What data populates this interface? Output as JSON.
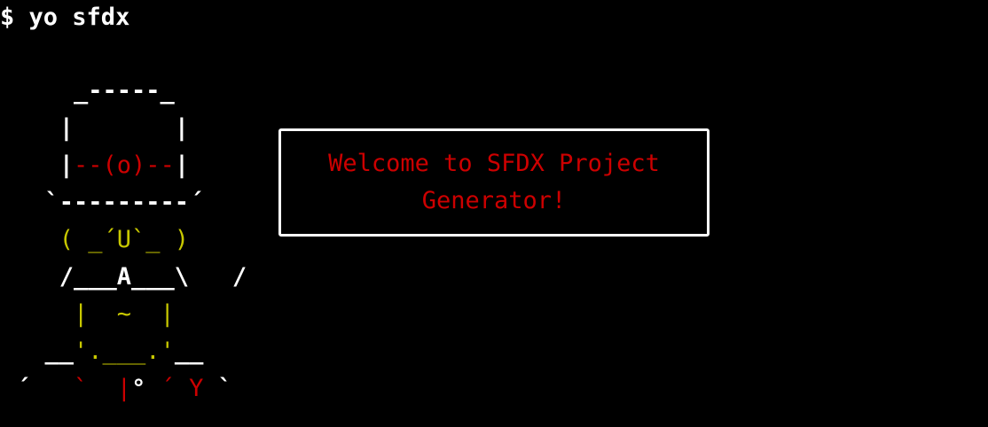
{
  "terminal": {
    "prompt_symbol": "$",
    "command": "yo sfdx"
  },
  "ascii_art": {
    "lines": [
      [
        {
          "text": "    _-----_",
          "color": "white"
        }
      ],
      [
        {
          "text": "   |       |",
          "color": "white"
        }
      ],
      [
        {
          "text": "   |",
          "color": "white"
        },
        {
          "text": "--(o)--",
          "color": "red"
        },
        {
          "text": "|",
          "color": "white"
        }
      ],
      [
        {
          "text": "  `---------´",
          "color": "white"
        }
      ],
      [
        {
          "text": "   ( _´U`_ )",
          "color": "yellow"
        }
      ],
      [
        {
          "text": "   /___A___\\   /",
          "color": "white"
        }
      ],
      [
        {
          "text": "    |  ~  |",
          "color": "yellow"
        }
      ],
      [
        {
          "text": "  __",
          "color": "white"
        },
        {
          "text": "'.___.'",
          "color": "yellow"
        },
        {
          "text": "__",
          "color": "white"
        }
      ],
      [
        {
          "text": "´   ",
          "color": "white"
        },
        {
          "text": "`  |",
          "color": "red"
        },
        {
          "text": "° ",
          "color": "white"
        },
        {
          "text": "´ Y",
          "color": "red"
        },
        {
          "text": " `",
          "color": "white"
        }
      ]
    ]
  },
  "message_box": {
    "line1": "Welcome to SFDX Project",
    "line2": "Generator!"
  },
  "colors": {
    "background": "#000000",
    "white": "#ffffff",
    "red": "#cc0000",
    "yellow": "#c8c800"
  }
}
